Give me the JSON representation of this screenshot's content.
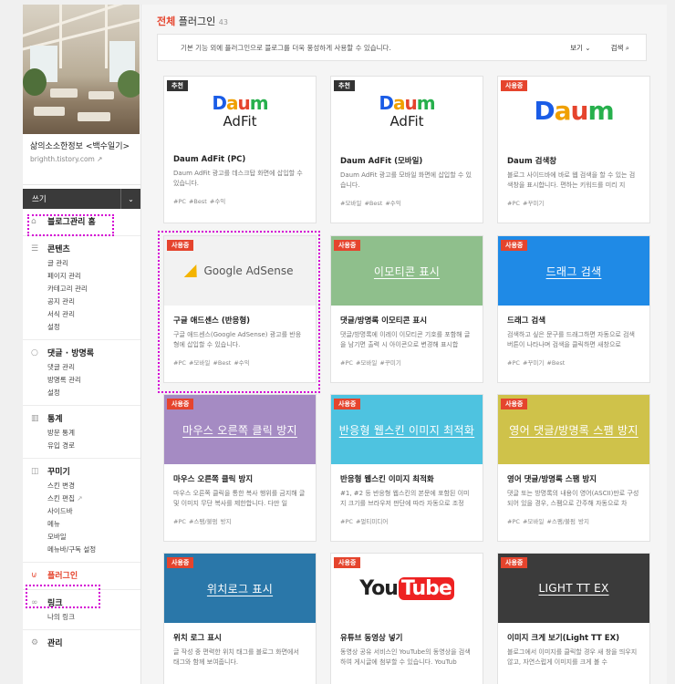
{
  "sidebar": {
    "blog_title": "삶의소소한정보 <백수일기>",
    "blog_url": "brighth.tistory.com",
    "write_label": "쓰기",
    "home_label": "블로그관리 홈",
    "groups": [
      {
        "title": "콘텐츠",
        "icon": "document-icon",
        "items": [
          "글 관리",
          "페이지 관리",
          "카테고리 관리",
          "공지 관리",
          "서식 관리",
          "설정"
        ]
      },
      {
        "title": "댓글 · 방명록",
        "icon": "comment-icon",
        "items": [
          "댓글 관리",
          "방명록 관리",
          "설정"
        ]
      },
      {
        "title": "통계",
        "icon": "stats-icon",
        "items": [
          "방문 통계",
          "유입 경로"
        ]
      },
      {
        "title": "꾸미기",
        "icon": "decorate-icon",
        "items": [
          "스킨 변경",
          "스킨 편집",
          "사이드바",
          "메뉴",
          "모바일",
          "메뉴바/구독 설정"
        ]
      }
    ],
    "plugin_label": "플러그인",
    "link_group": {
      "title": "링크",
      "items": [
        "나의 링크"
      ]
    },
    "manage_label": "관리"
  },
  "header": {
    "title_red": "전체",
    "title_rest": "플러그인",
    "count": "43",
    "info_text": "기본 기능 외에 플러그인으로 블로그를 더욱 풍성하게 사용할 수 있습니다.",
    "view_label": "보기",
    "search_label": "검색"
  },
  "plugins": [
    {
      "badge": "추천",
      "badge_style": "dark",
      "thumb": "adfit",
      "title": "Daum AdFit (PC)",
      "desc": "Daum AdFit 광고를 데스크탑 화면에 삽입할 수 있습니다.",
      "tags": "#PC  #Best  #수익"
    },
    {
      "badge": "추천",
      "badge_style": "dark",
      "thumb": "adfit",
      "title": "Daum AdFit (모바일)",
      "desc": "Daum AdFit 광고를 모바일 화면에 삽입할 수 있습니다.",
      "tags": "#모바일  #Best  #수익"
    },
    {
      "badge": "사용중",
      "badge_style": "red",
      "thumb": "daum",
      "title": "Daum 검색창",
      "desc": "블로그 사이드바에 바로 웹 검색을 할 수 있는 검색창을 표시합니다. 편하는 키워드를 미리 지",
      "tags": "#PC  #꾸미기"
    },
    {
      "badge": "사용중",
      "badge_style": "red",
      "thumb": "adsense",
      "title": "구글 애드센스 (반응형)",
      "desc": "구글 애드센스(Google AdSense) 광고를 반응형에 삽입할 수 있습니다.",
      "tags": "#PC  #모바일  #Best  #수익"
    },
    {
      "badge": "사용중",
      "badge_style": "red",
      "thumb": "text",
      "thumb_text": "이모티콘 표시",
      "color": "#8fbf8c",
      "title": "댓글/방명록 이모티콘 표시",
      "desc": "댓글/방명록에 이레이 이모티콘 기호를 포함해 글을 남기면 출력 시 아이콘으로 변경해 표시합",
      "tags": "#PC  #모바일  #꾸미기"
    },
    {
      "badge": "사용중",
      "badge_style": "red",
      "thumb": "text",
      "thumb_text": "드래그 검색",
      "color": "#1f8ae6",
      "title": "드래그 검색",
      "desc": "검색하고 싶은 문구를 드래그하면 자동으로 검색 버튼이 나타나며 검색을 클릭하면 새창으로",
      "tags": "#PC  #꾸미기  #Best"
    },
    {
      "badge": "사용중",
      "badge_style": "red",
      "thumb": "text",
      "thumb_text": "마우스 오른쪽 클릭 방지",
      "color": "#a58bc3",
      "title": "마우스 오른쪽 클릭 방지",
      "desc": "마우스 오른쪽 클릭을 통한 복사 행위를 금지해 글 및 이미지 무단 복사를 제한합니다. 다만 일",
      "tags": "#PC  #스팸/불펌 방지"
    },
    {
      "badge": "사용중",
      "badge_style": "red",
      "thumb": "text",
      "thumb_text": "반응형 웹스킨 이미지 최적화",
      "color": "#4ec3e0",
      "title": "반응형 웹스킨 이미지 최적화",
      "desc": "#1, #2 등 반응형 웹스킨의 본문에 포함된 이미지 크기를 브라우저 판단에 따라 자동으로 조정",
      "tags": "#PC  #멀티미디어"
    },
    {
      "badge": "사용중",
      "badge_style": "red",
      "thumb": "text",
      "thumb_text": "영어 댓글/방명록 스팸 방지",
      "color": "#cfc24a",
      "title": "영어 댓글/방명록 스팸 방지",
      "desc": "댓글 또는 방명록의 내용이 영어(ASCII)만로 구성되어 있을 경우, 스팸으로 간주해 자동으로 차",
      "tags": "#PC  #모바일  #스팸/불펌 방지"
    },
    {
      "badge": "사용중",
      "badge_style": "red",
      "thumb": "text",
      "thumb_text": "위치로그 표시",
      "color": "#2a77a9",
      "title": "위치 로그 표시",
      "desc": "글 작성 중 편력한 위치 태그를 블로그 화면에서 태그와 함께 보여줍니다.",
      "tags": ""
    },
    {
      "badge": "사용중",
      "badge_style": "red",
      "thumb": "youtube",
      "title": "유튜브 동영상 넣기",
      "desc": "동영상 공유 서비스인 YouTube의 동영상을 검색하여 게시글에 첨부할 수 있습니다. YouTub",
      "tags": ""
    },
    {
      "badge": "사용중",
      "badge_style": "red",
      "thumb": "text",
      "thumb_text": "LIGHT TT EX",
      "color": "#3b3b3b",
      "title": "이미지 크게 보기(Light TT EX)",
      "desc": "블로그에서 이미지를 클릭할 경우 새 창을 띄우지 않고, 자연스럽게 이미지를 크게 볼 수",
      "tags": ""
    }
  ],
  "logos": {
    "daum": "Daum",
    "adfit": "AdFit",
    "adsense": "Google AdSense",
    "youtube_you": "You",
    "youtube_tube": "Tube"
  },
  "colors": {
    "accent": "#e5442d",
    "highlight": "#d400d4"
  }
}
